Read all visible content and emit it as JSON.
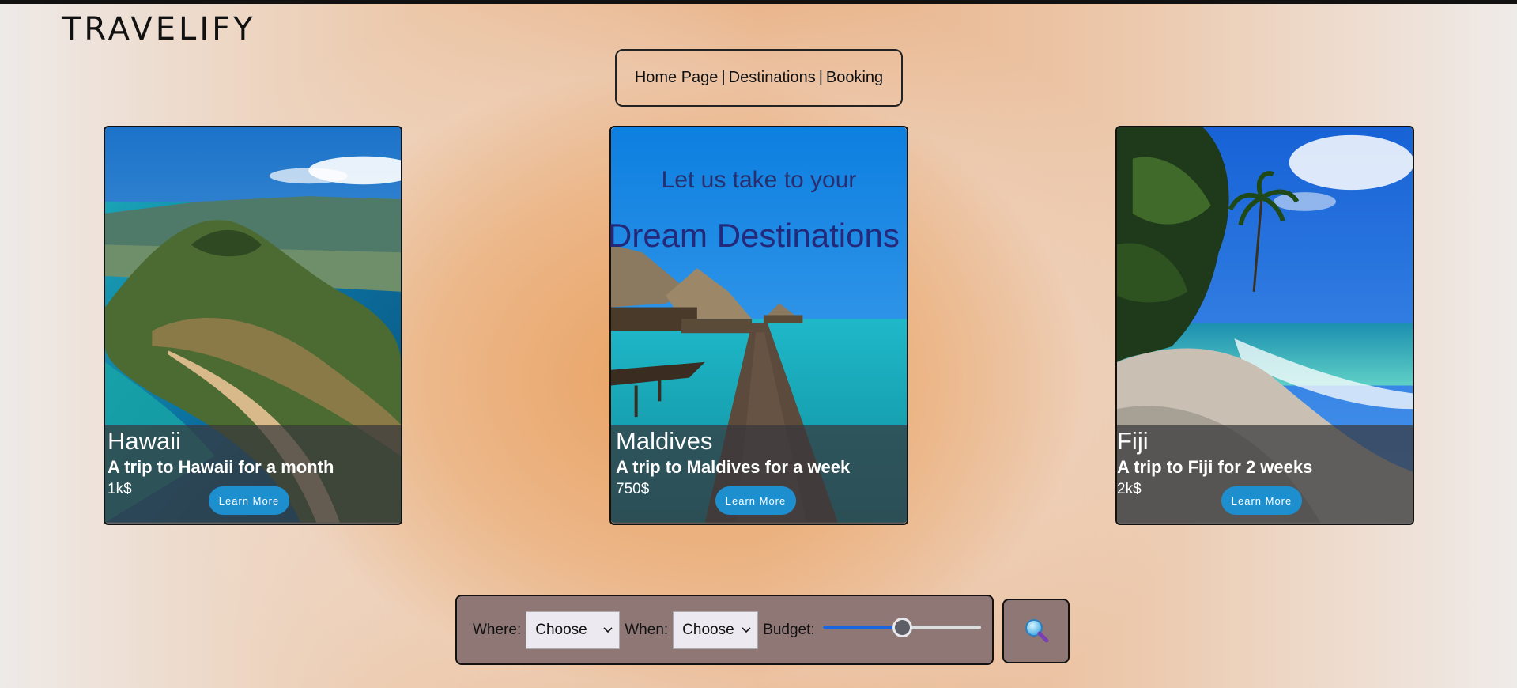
{
  "brand": {
    "logo": "TRAVELIFY"
  },
  "nav": {
    "items": [
      "Home Page",
      "Destinations",
      "Booking"
    ],
    "separator": "|"
  },
  "hero": {
    "line1": "Let us take to your",
    "line2": "Dream Destinations"
  },
  "cards": [
    {
      "title": "Hawaii",
      "subtitle": "A trip to Hawaii for a month",
      "price": "1k$",
      "button": "Learn More"
    },
    {
      "title": "Maldives",
      "subtitle": "A trip to Maldives for a week",
      "price": "750$",
      "button": "Learn More"
    },
    {
      "title": "Fiji",
      "subtitle": "A trip to Fiji for 2 weeks",
      "price": "2k$",
      "button": "Learn More"
    }
  ],
  "search": {
    "where_label": "Where:",
    "where_value": "Choose",
    "when_label": "When:",
    "when_value": "Choose",
    "budget_label": "Budget:",
    "budget_level": 0.5,
    "search_icon": "magnifier-icon"
  },
  "colors": {
    "accent": "#1d8fcf",
    "hero_text": "#25297a",
    "panel": "#8f7776"
  }
}
